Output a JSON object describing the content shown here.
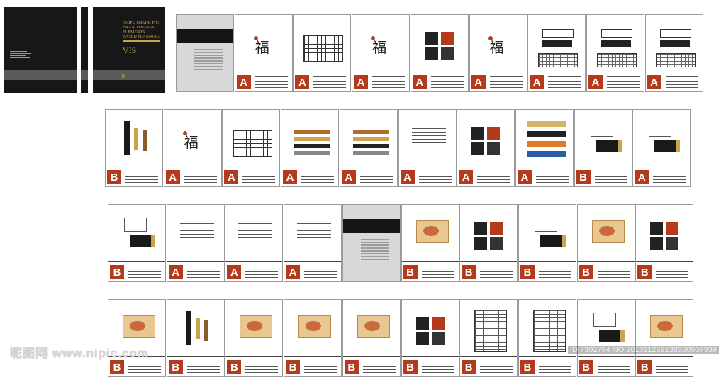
{
  "cover": {
    "title_lines": [
      "CHIFU SHARK FIN",
      "BRAND DESIGN",
      "ELEMENTS",
      "BASED PLANNING"
    ],
    "vis_label": "VIS"
  },
  "rows": [
    {
      "pages": [
        {
          "kind": "gray"
        },
        {
          "kind": "logo",
          "label": "A"
        },
        {
          "kind": "grid",
          "label": "A"
        },
        {
          "kind": "logo",
          "label": "A"
        },
        {
          "kind": "blocks",
          "label": "A"
        },
        {
          "kind": "logo",
          "label": "A"
        },
        {
          "kind": "wordmark",
          "label": "A"
        },
        {
          "kind": "wordmark",
          "label": "A"
        },
        {
          "kind": "wordmark",
          "label": "A"
        }
      ]
    },
    {
      "pages": [
        {
          "kind": "tags",
          "label": "B"
        },
        {
          "kind": "logo",
          "label": "A"
        },
        {
          "kind": "grid",
          "label": "A"
        },
        {
          "kind": "swatch",
          "label": "A"
        },
        {
          "kind": "swatch",
          "label": "A"
        },
        {
          "kind": "list",
          "label": "A"
        },
        {
          "kind": "blocks",
          "label": "A"
        },
        {
          "kind": "stripes",
          "label": "A"
        },
        {
          "kind": "cards",
          "label": "B"
        },
        {
          "kind": "cards",
          "label": "A"
        }
      ]
    },
    {
      "pages": [
        {
          "kind": "cards",
          "label": "B"
        },
        {
          "kind": "list",
          "label": "A"
        },
        {
          "kind": "list",
          "label": "A"
        },
        {
          "kind": "list",
          "label": "A"
        },
        {
          "kind": "gray"
        },
        {
          "kind": "photo",
          "label": "B"
        },
        {
          "kind": "blocks",
          "label": "B"
        },
        {
          "kind": "cards",
          "label": "B"
        },
        {
          "kind": "photo",
          "label": "B"
        },
        {
          "kind": "blocks",
          "label": "B"
        }
      ]
    },
    {
      "pages": [
        {
          "kind": "photo",
          "label": "B"
        },
        {
          "kind": "tags",
          "label": "B"
        },
        {
          "kind": "photo",
          "label": "B"
        },
        {
          "kind": "photo",
          "label": "B"
        },
        {
          "kind": "photo",
          "label": "B"
        },
        {
          "kind": "blocks",
          "label": "B"
        },
        {
          "kind": "table",
          "label": "B"
        },
        {
          "kind": "table",
          "label": "B"
        },
        {
          "kind": "cards",
          "label": "B"
        },
        {
          "kind": "photo",
          "label": "B"
        }
      ]
    }
  ],
  "watermark": {
    "left": "昵图网 www.nipic.com",
    "right": "ID:7302794 NO:201011282138380007939"
  },
  "colors": {
    "accent_red": "#b33a1c",
    "cover_dark": "#171717",
    "gold": "#c9a44a"
  }
}
